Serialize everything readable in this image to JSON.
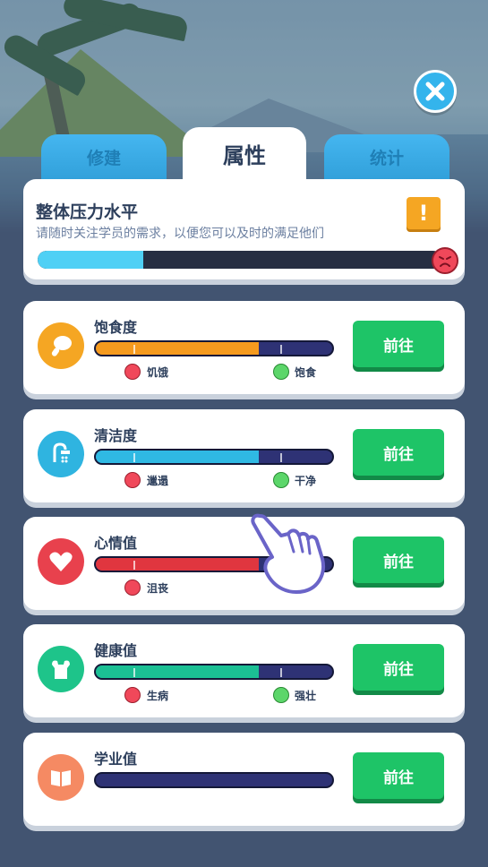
{
  "tabs": [
    {
      "label": "修建"
    },
    {
      "label": "属性"
    },
    {
      "label": "统计"
    }
  ],
  "close_icon": "close-icon",
  "stress": {
    "title": "整体压力水平",
    "subtitle": "请随时关注学员的需求，以便您可以及时的满足他们",
    "level": 0.26,
    "warning_icon": "!"
  },
  "stats": [
    {
      "id": "satiety",
      "label": "饱食度",
      "fill": 0.69,
      "bad_label": "饥饿",
      "good_label": "饱食",
      "button": "前往",
      "icon": "drumstick-icon",
      "icon_color": "#f5a623",
      "fill_color": "#f59a1e"
    },
    {
      "id": "cleanliness",
      "label": "清洁度",
      "fill": 0.69,
      "bad_label": "邋遢",
      "good_label": "干净",
      "button": "前往",
      "icon": "shower-icon",
      "icon_color": "#2fb4e0",
      "fill_color": "#2fb9e3"
    },
    {
      "id": "mood",
      "label": "心情值",
      "fill": 0.69,
      "bad_label": "沮丧",
      "good_label": "",
      "button": "前往",
      "icon": "heart-icon",
      "icon_color": "#e8414d",
      "fill_color": "#e0363f"
    },
    {
      "id": "health",
      "label": "健康值",
      "fill": 0.69,
      "bad_label": "生病",
      "good_label": "强壮",
      "button": "前往",
      "icon": "muscle-icon",
      "icon_color": "#1ec48a",
      "fill_color": "#1bbf94"
    },
    {
      "id": "study",
      "label": "学业值",
      "fill": 0.0,
      "bad_label": "",
      "good_label": "",
      "button": "前往",
      "icon": "book-icon",
      "icon_color": "#f58a63",
      "fill_color": "#f58a63"
    }
  ]
}
